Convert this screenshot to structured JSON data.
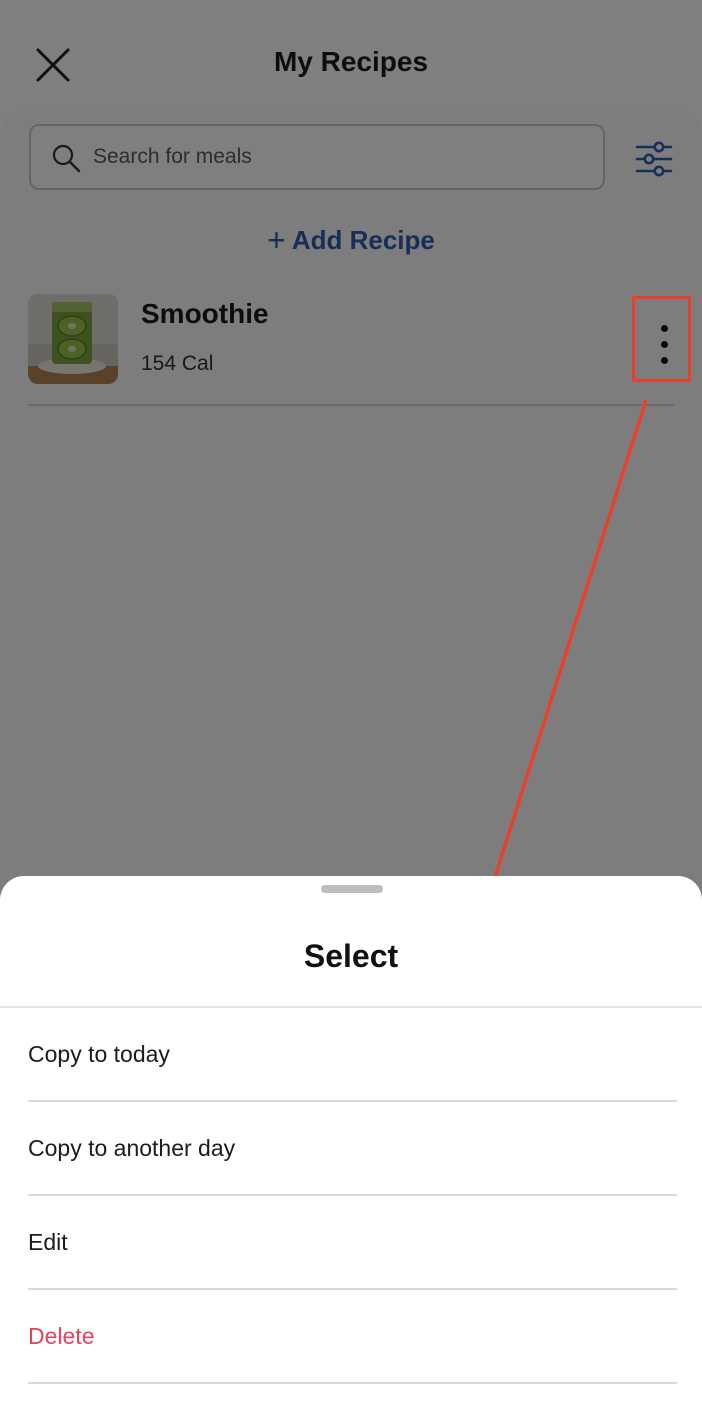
{
  "header": {
    "title": "My Recipes",
    "close_icon": "close-icon"
  },
  "search": {
    "placeholder": "Search for meals",
    "value": "",
    "filter_icon": "sliders-filter-icon"
  },
  "add_recipe": {
    "label": "Add Recipe",
    "icon": "+"
  },
  "recipes": [
    {
      "name": "Smoothie",
      "calories": "154 Cal",
      "thumbnail": "kiwi-smoothie-photo"
    }
  ],
  "sheet": {
    "title": "Select",
    "options": [
      {
        "label": "Copy to today",
        "danger": false
      },
      {
        "label": "Copy to another day",
        "danger": false
      },
      {
        "label": "Edit",
        "danger": false
      },
      {
        "label": "Delete",
        "danger": true
      }
    ]
  },
  "colors": {
    "accent": "#2f5cb3",
    "danger": "#e0455e",
    "annotation": "#e8402a",
    "overlay": "rgba(0,0,0,0.5)"
  }
}
